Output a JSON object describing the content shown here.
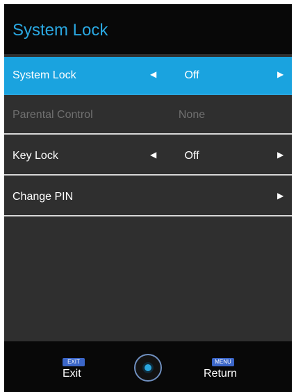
{
  "header": {
    "title": "System Lock"
  },
  "menu": {
    "items": [
      {
        "label": "System Lock",
        "value": "Off",
        "state": "selected"
      },
      {
        "label": "Parental Control",
        "value": "None",
        "state": "disabled"
      },
      {
        "label": "Key Lock",
        "value": "Off",
        "state": "normal"
      },
      {
        "label": "Change PIN",
        "value": "",
        "state": "normal"
      }
    ]
  },
  "footer": {
    "exit_badge": "EXIT",
    "exit_label": "Exit",
    "menu_badge": "MENU",
    "return_label": "Return"
  },
  "colors": {
    "accent": "#1aa3df",
    "title": "#2aa7e0",
    "background": "#0a0a0a",
    "menu_background": "#2f2f2f",
    "badge": "#3b66c8"
  },
  "icons": {
    "left_arrow": "left-triangle-icon",
    "right_arrow": "right-triangle-icon",
    "dpad": "dpad-icon"
  }
}
